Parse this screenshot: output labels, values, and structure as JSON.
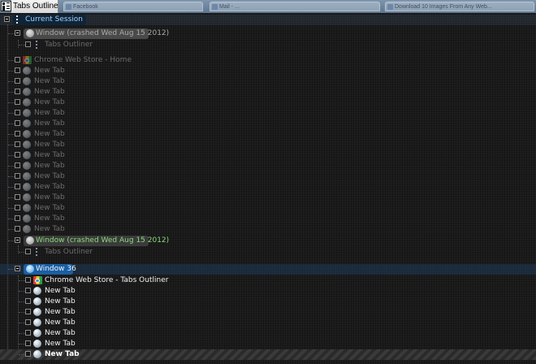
{
  "window": {
    "title": "Tabs Outliner",
    "icon": "tabs-outliner-app-icon",
    "background_tabs": [
      "Facebook",
      "Mail - ...",
      "Download 10 Images From Any Web..."
    ]
  },
  "tree": {
    "session": {
      "label": "Current Session",
      "icon": "tabs-outliner-icon",
      "expanded": true
    },
    "crashed_window_1": {
      "label": "Window (crashed Wed Aug 15 2012)",
      "icon": "window-icon",
      "expanded": true,
      "children": [
        {
          "label": "Tabs Outliner",
          "icon": "tabs-outliner-icon"
        }
      ]
    },
    "orphan_tabs": [
      {
        "label": "Chrome Web Store - Home",
        "icon": "chrome-web-store-icon"
      },
      {
        "label": "New Tab",
        "icon": "globe-icon"
      },
      {
        "label": "New Tab",
        "icon": "globe-icon"
      },
      {
        "label": "New Tab",
        "icon": "globe-icon"
      },
      {
        "label": "New Tab",
        "icon": "globe-icon"
      },
      {
        "label": "New Tab",
        "icon": "globe-icon"
      },
      {
        "label": "New Tab",
        "icon": "globe-icon"
      },
      {
        "label": "New Tab",
        "icon": "globe-icon"
      },
      {
        "label": "New Tab",
        "icon": "globe-icon"
      },
      {
        "label": "New Tab",
        "icon": "globe-icon"
      },
      {
        "label": "New Tab",
        "icon": "globe-icon"
      },
      {
        "label": "New Tab",
        "icon": "globe-icon"
      },
      {
        "label": "New Tab",
        "icon": "globe-icon"
      },
      {
        "label": "New Tab",
        "icon": "globe-icon"
      },
      {
        "label": "New Tab",
        "icon": "globe-icon"
      },
      {
        "label": "New Tab",
        "icon": "globe-icon"
      },
      {
        "label": "New Tab",
        "icon": "globe-icon"
      }
    ],
    "crashed_window_2": {
      "label": "Window (crashed Wed Aug 15 2012)",
      "icon": "window-icon",
      "expanded": true,
      "children": [
        {
          "label": "Tabs Outliner",
          "icon": "tabs-outliner-icon"
        }
      ]
    },
    "window_36": {
      "label": "Window 36",
      "icon": "window-icon",
      "expanded": true,
      "children": [
        {
          "label": "Chrome Web Store - Tabs Outliner",
          "icon": "chrome-web-store-icon"
        },
        {
          "label": "New Tab",
          "icon": "globe-icon"
        },
        {
          "label": "New Tab",
          "icon": "globe-icon"
        },
        {
          "label": "New Tab",
          "icon": "globe-icon"
        },
        {
          "label": "New Tab",
          "icon": "globe-icon"
        },
        {
          "label": "New Tab",
          "icon": "globe-icon"
        },
        {
          "label": "New Tab",
          "icon": "globe-icon"
        },
        {
          "label": "New Tab",
          "icon": "globe-icon",
          "active": true
        }
      ]
    }
  },
  "colors": {
    "background": "#1b1b1b",
    "session_text": "#9ed2ff",
    "crashed_active_text": "#8cd97c",
    "window_36_pill": "#1b5fa3",
    "saved_tab_text": "#6c6c6c",
    "open_tab_text": "#f0f0f0"
  }
}
